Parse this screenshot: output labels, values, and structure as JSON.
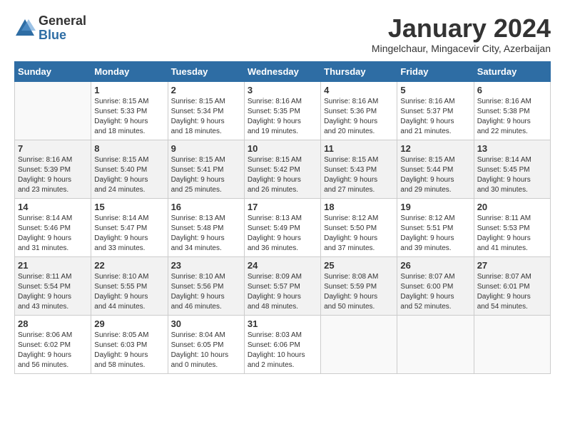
{
  "header": {
    "logo_general": "General",
    "logo_blue": "Blue",
    "month_title": "January 2024",
    "subtitle": "Mingelchaur, Mingacevir City, Azerbaijan"
  },
  "weekdays": [
    "Sunday",
    "Monday",
    "Tuesday",
    "Wednesday",
    "Thursday",
    "Friday",
    "Saturday"
  ],
  "weeks": [
    [
      {
        "day": "",
        "sunrise": "",
        "sunset": "",
        "daylight": ""
      },
      {
        "day": "1",
        "sunrise": "Sunrise: 8:15 AM",
        "sunset": "Sunset: 5:33 PM",
        "daylight": "Daylight: 9 hours and 18 minutes."
      },
      {
        "day": "2",
        "sunrise": "Sunrise: 8:15 AM",
        "sunset": "Sunset: 5:34 PM",
        "daylight": "Daylight: 9 hours and 18 minutes."
      },
      {
        "day": "3",
        "sunrise": "Sunrise: 8:16 AM",
        "sunset": "Sunset: 5:35 PM",
        "daylight": "Daylight: 9 hours and 19 minutes."
      },
      {
        "day": "4",
        "sunrise": "Sunrise: 8:16 AM",
        "sunset": "Sunset: 5:36 PM",
        "daylight": "Daylight: 9 hours and 20 minutes."
      },
      {
        "day": "5",
        "sunrise": "Sunrise: 8:16 AM",
        "sunset": "Sunset: 5:37 PM",
        "daylight": "Daylight: 9 hours and 21 minutes."
      },
      {
        "day": "6",
        "sunrise": "Sunrise: 8:16 AM",
        "sunset": "Sunset: 5:38 PM",
        "daylight": "Daylight: 9 hours and 22 minutes."
      }
    ],
    [
      {
        "day": "7",
        "sunrise": "Sunrise: 8:16 AM",
        "sunset": "Sunset: 5:39 PM",
        "daylight": "Daylight: 9 hours and 23 minutes."
      },
      {
        "day": "8",
        "sunrise": "Sunrise: 8:15 AM",
        "sunset": "Sunset: 5:40 PM",
        "daylight": "Daylight: 9 hours and 24 minutes."
      },
      {
        "day": "9",
        "sunrise": "Sunrise: 8:15 AM",
        "sunset": "Sunset: 5:41 PM",
        "daylight": "Daylight: 9 hours and 25 minutes."
      },
      {
        "day": "10",
        "sunrise": "Sunrise: 8:15 AM",
        "sunset": "Sunset: 5:42 PM",
        "daylight": "Daylight: 9 hours and 26 minutes."
      },
      {
        "day": "11",
        "sunrise": "Sunrise: 8:15 AM",
        "sunset": "Sunset: 5:43 PM",
        "daylight": "Daylight: 9 hours and 27 minutes."
      },
      {
        "day": "12",
        "sunrise": "Sunrise: 8:15 AM",
        "sunset": "Sunset: 5:44 PM",
        "daylight": "Daylight: 9 hours and 29 minutes."
      },
      {
        "day": "13",
        "sunrise": "Sunrise: 8:14 AM",
        "sunset": "Sunset: 5:45 PM",
        "daylight": "Daylight: 9 hours and 30 minutes."
      }
    ],
    [
      {
        "day": "14",
        "sunrise": "Sunrise: 8:14 AM",
        "sunset": "Sunset: 5:46 PM",
        "daylight": "Daylight: 9 hours and 31 minutes."
      },
      {
        "day": "15",
        "sunrise": "Sunrise: 8:14 AM",
        "sunset": "Sunset: 5:47 PM",
        "daylight": "Daylight: 9 hours and 33 minutes."
      },
      {
        "day": "16",
        "sunrise": "Sunrise: 8:13 AM",
        "sunset": "Sunset: 5:48 PM",
        "daylight": "Daylight: 9 hours and 34 minutes."
      },
      {
        "day": "17",
        "sunrise": "Sunrise: 8:13 AM",
        "sunset": "Sunset: 5:49 PM",
        "daylight": "Daylight: 9 hours and 36 minutes."
      },
      {
        "day": "18",
        "sunrise": "Sunrise: 8:12 AM",
        "sunset": "Sunset: 5:50 PM",
        "daylight": "Daylight: 9 hours and 37 minutes."
      },
      {
        "day": "19",
        "sunrise": "Sunrise: 8:12 AM",
        "sunset": "Sunset: 5:51 PM",
        "daylight": "Daylight: 9 hours and 39 minutes."
      },
      {
        "day": "20",
        "sunrise": "Sunrise: 8:11 AM",
        "sunset": "Sunset: 5:53 PM",
        "daylight": "Daylight: 9 hours and 41 minutes."
      }
    ],
    [
      {
        "day": "21",
        "sunrise": "Sunrise: 8:11 AM",
        "sunset": "Sunset: 5:54 PM",
        "daylight": "Daylight: 9 hours and 43 minutes."
      },
      {
        "day": "22",
        "sunrise": "Sunrise: 8:10 AM",
        "sunset": "Sunset: 5:55 PM",
        "daylight": "Daylight: 9 hours and 44 minutes."
      },
      {
        "day": "23",
        "sunrise": "Sunrise: 8:10 AM",
        "sunset": "Sunset: 5:56 PM",
        "daylight": "Daylight: 9 hours and 46 minutes."
      },
      {
        "day": "24",
        "sunrise": "Sunrise: 8:09 AM",
        "sunset": "Sunset: 5:57 PM",
        "daylight": "Daylight: 9 hours and 48 minutes."
      },
      {
        "day": "25",
        "sunrise": "Sunrise: 8:08 AM",
        "sunset": "Sunset: 5:59 PM",
        "daylight": "Daylight: 9 hours and 50 minutes."
      },
      {
        "day": "26",
        "sunrise": "Sunrise: 8:07 AM",
        "sunset": "Sunset: 6:00 PM",
        "daylight": "Daylight: 9 hours and 52 minutes."
      },
      {
        "day": "27",
        "sunrise": "Sunrise: 8:07 AM",
        "sunset": "Sunset: 6:01 PM",
        "daylight": "Daylight: 9 hours and 54 minutes."
      }
    ],
    [
      {
        "day": "28",
        "sunrise": "Sunrise: 8:06 AM",
        "sunset": "Sunset: 6:02 PM",
        "daylight": "Daylight: 9 hours and 56 minutes."
      },
      {
        "day": "29",
        "sunrise": "Sunrise: 8:05 AM",
        "sunset": "Sunset: 6:03 PM",
        "daylight": "Daylight: 9 hours and 58 minutes."
      },
      {
        "day": "30",
        "sunrise": "Sunrise: 8:04 AM",
        "sunset": "Sunset: 6:05 PM",
        "daylight": "Daylight: 10 hours and 0 minutes."
      },
      {
        "day": "31",
        "sunrise": "Sunrise: 8:03 AM",
        "sunset": "Sunset: 6:06 PM",
        "daylight": "Daylight: 10 hours and 2 minutes."
      },
      {
        "day": "",
        "sunrise": "",
        "sunset": "",
        "daylight": ""
      },
      {
        "day": "",
        "sunrise": "",
        "sunset": "",
        "daylight": ""
      },
      {
        "day": "",
        "sunrise": "",
        "sunset": "",
        "daylight": ""
      }
    ]
  ]
}
